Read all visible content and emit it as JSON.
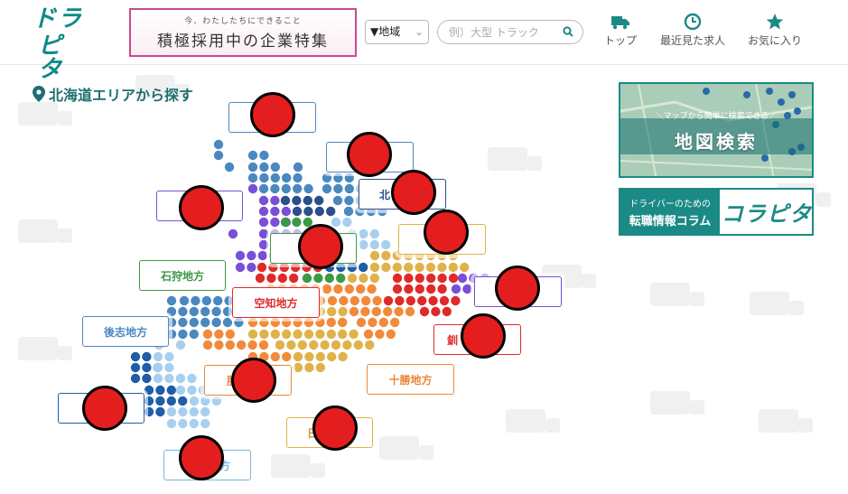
{
  "header": {
    "logo_line1": "ドラ",
    "logo_line2": "ピタ",
    "banner_sub": "今、わたしたちにできること",
    "banner_main": "積極採用中の企業特集",
    "region_select": "▼地域",
    "search_placeholder": "例）大型 トラック",
    "nav": {
      "top": "トップ",
      "recent": "最近見た求人",
      "favorites": "お気に入り"
    }
  },
  "page": {
    "title": "北海道エリアから探す"
  },
  "regions": [
    {
      "id": "ishikari",
      "label": "石狩地方",
      "color": "#3c9a45"
    },
    {
      "id": "sorachi",
      "label": "空知地方",
      "color": "#e02a2a"
    },
    {
      "id": "shiribeshi",
      "label": "後志地方",
      "color": "#4a88c0"
    },
    {
      "id": "tokachi",
      "label": "十勝地方",
      "color": "#e8883a"
    },
    {
      "id": "kamikawa",
      "label": "北",
      "color": "#2b4f8a"
    },
    {
      "id": "iburi",
      "label": "胆",
      "color": "#e8883a"
    },
    {
      "id": "hidaka",
      "label": "日",
      "color": "#e0b24a"
    },
    {
      "id": "oshima",
      "label": "方",
      "color": "#7ab6e0"
    },
    {
      "id": "kushiro",
      "label": "釧",
      "color": "#e02a2a"
    },
    {
      "id": "soya",
      "label": "",
      "color": "#4a88c0"
    },
    {
      "id": "rumoi",
      "label": "",
      "color": "#7a4fd6"
    },
    {
      "id": "okhotsk",
      "label": "",
      "color": "#e0b24a"
    },
    {
      "id": "nemuro",
      "label": "",
      "color": "#7a4fd6"
    },
    {
      "id": "hiyama",
      "label": "",
      "color": "#1f5da8"
    },
    {
      "id": "abashiri",
      "label": "",
      "color": "#4a88c0"
    }
  ],
  "side": {
    "map_caption": "＼マップから簡単に検索できる／",
    "map_title": "地図検索",
    "column_line1": "ドライバーのための",
    "column_line2": "転職情報コラム",
    "column_logo": "コラピタ"
  }
}
